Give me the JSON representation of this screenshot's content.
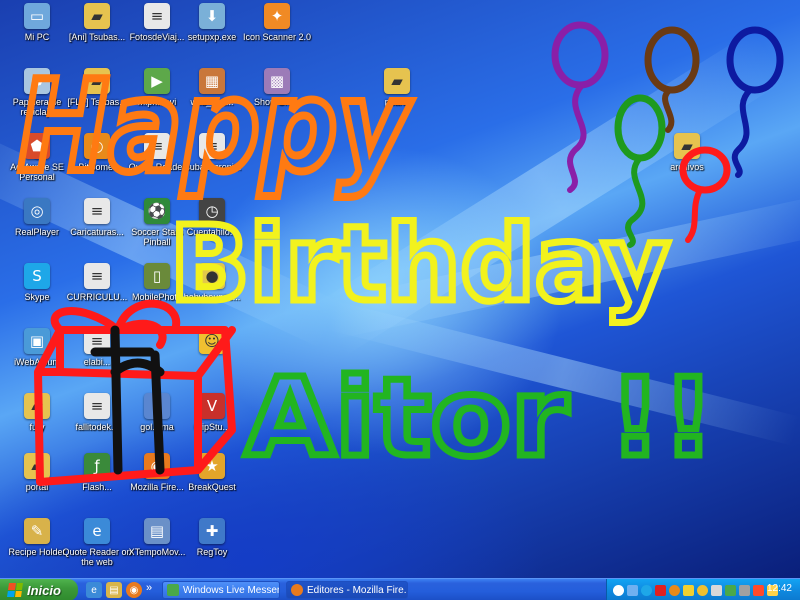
{
  "desktop_icons": [
    {
      "label": "Mi PC",
      "glyph": "computer-icon",
      "color": "#6fa8dc"
    },
    {
      "label": "[Ani] Tsubas...",
      "glyph": "folder-icon",
      "color": "#e6c34f"
    },
    {
      "label": "FotosdeViaj...",
      "glyph": "document-icon",
      "color": "#e8e8e8"
    },
    {
      "label": "setupxp.exe",
      "glyph": "installer-icon",
      "color": "#7ab0d8"
    },
    {
      "label": "Icon Scanner 2.0",
      "glyph": "scanner-icon",
      "color": "#f08a24"
    },
    {
      "label": "Papelera de reciclaje",
      "glyph": "recycle-bin-icon",
      "color": "#a9c6e0"
    },
    {
      "label": "[FLF] Tsubas...",
      "glyph": "folder-icon",
      "color": "#e6c34f"
    },
    {
      "label": "Mipri...avi",
      "glyph": "media-icon",
      "color": "#5da84a"
    },
    {
      "label": "wild_1_1...",
      "glyph": "archive-icon",
      "color": "#c9773a"
    },
    {
      "label": "Shop Gra...",
      "glyph": "grid-icon",
      "color": "#9c7bb8"
    },
    {
      "label": "pcana",
      "glyph": "folder-icon",
      "color": "#e6c34f"
    },
    {
      "label": "Ad-Aware SE Personal",
      "glyph": "shield-icon",
      "color": "#d94b2b"
    },
    {
      "label": "BitComet",
      "glyph": "bitcomet-icon",
      "color": "#e88a1a"
    },
    {
      "label": "Quote Reader",
      "glyph": "document-icon",
      "color": "#e8e8e8"
    },
    {
      "label": "tsubasacroni...",
      "glyph": "document-icon",
      "color": "#e8e8e8"
    },
    {
      "label": "archivos",
      "glyph": "folder-icon",
      "color": "#e6c34f"
    },
    {
      "label": "RealPlayer",
      "glyph": "realplayer-icon",
      "color": "#3a78c2"
    },
    {
      "label": "Caricaturas...",
      "glyph": "document-icon",
      "color": "#e8e8e8"
    },
    {
      "label": "Soccer Stars Pinball",
      "glyph": "game-icon",
      "color": "#2f8a3a"
    },
    {
      "label": "Cuentahilo...",
      "glyph": "clock-icon",
      "color": "#444444"
    },
    {
      "label": "Skype",
      "glyph": "skype-icon",
      "color": "#1ea7e8"
    },
    {
      "label": "CURRICULU...",
      "glyph": "document-icon",
      "color": "#e8e8e8"
    },
    {
      "label": "MobilePhoto",
      "glyph": "phone-icon",
      "color": "#6a8a3a"
    },
    {
      "label": "babybounce...",
      "glyph": "ball-icon",
      "color": "#e2c84a"
    },
    {
      "label": "iWebAlbum",
      "glyph": "album-icon",
      "color": "#4a9ad8"
    },
    {
      "label": "elabi...",
      "glyph": "document-icon",
      "color": "#e8e8e8"
    },
    {
      "label": "",
      "glyph": "smiley-icon",
      "color": "#f0c030"
    },
    {
      "label": "fury",
      "glyph": "folder-icon",
      "color": "#e6c34f"
    },
    {
      "label": "fallitodek...",
      "glyph": "document-icon",
      "color": "#e8e8e8"
    },
    {
      "label": "gol.wma",
      "glyph": "audio-icon",
      "color": "#5a86d0"
    },
    {
      "label": "roipStu...",
      "glyph": "vs-icon",
      "color": "#c8302a"
    },
    {
      "label": "portal",
      "glyph": "folder-icon",
      "color": "#e6c34f"
    },
    {
      "label": "Flash...",
      "glyph": "flash-icon",
      "color": "#3a8a3a"
    },
    {
      "label": "Mozilla Fire...",
      "glyph": "firefox-icon",
      "color": "#e87a1e"
    },
    {
      "label": "BreakQuest",
      "glyph": "breakquest-icon",
      "color": "#e3a52a"
    },
    {
      "label": "Recipe Holder",
      "glyph": "recipe-icon",
      "color": "#d8b24a"
    },
    {
      "label": "Quote Reader on the web",
      "glyph": "ie-icon",
      "color": "#3b8ad8"
    },
    {
      "label": "XTempoMov...",
      "glyph": "monitor-icon",
      "color": "#6a90c8"
    },
    {
      "label": "RegToy",
      "glyph": "regtoy-icon",
      "color": "#3f79c9"
    }
  ],
  "scribble": {
    "line1": "Happy",
    "line2": "Birthday",
    "line3": "Aitor !!",
    "colors": {
      "happy": "#ff7a12",
      "birthday": "#f2f21e",
      "aitor": "#22b520",
      "gift_box": "#ff1a1a",
      "gift_ribbon": "#111111"
    },
    "balloon_colors": [
      "#8a1fa8",
      "#1e9a1e",
      "#6a3a14",
      "#0d1aa0",
      "#ff1a1a"
    ]
  },
  "taskbar": {
    "start_label": "Inicio",
    "quick_launch": [
      "ie-icon",
      "explorer-icon",
      "firefox-icon"
    ],
    "overflow": "»",
    "tasks": [
      {
        "label": "Windows Live Messen...",
        "icon": "messenger-icon",
        "active": false
      },
      {
        "label": "Editores - Mozilla Fire...",
        "icon": "firefox-icon",
        "active": true
      }
    ],
    "tray_icons": [
      "help-icon",
      "network-icon",
      "skype-tray-icon",
      "zonealarm-icon",
      "bitcomet-tray-icon",
      "antivirus-icon",
      "smiley-tray-icon",
      "volume-icon",
      "messenger-tray-icon",
      "camera-icon",
      "flag-icon",
      "update-icon"
    ],
    "clock": "12:42"
  }
}
